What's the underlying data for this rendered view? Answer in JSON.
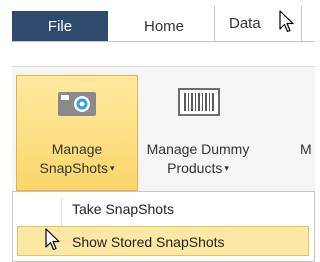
{
  "ribbon": {
    "tabs": [
      {
        "label": "File"
      },
      {
        "label": "Home"
      },
      {
        "label": "Data"
      }
    ],
    "groups": [
      {
        "label_line1": "Manage",
        "label_line2": "SnapShots",
        "icon": "camera-icon"
      },
      {
        "label_line1": "Manage Dummy",
        "label_line2": "Products",
        "icon": "barcode-icon"
      },
      {
        "label_line1": "M"
      }
    ],
    "dropdown_arrow": "▾"
  },
  "menu": {
    "items": [
      {
        "label": "Take SnapShots"
      },
      {
        "label": "Show Stored SnapShots"
      }
    ]
  },
  "colors": {
    "file_tab": "#2e4b6e",
    "highlight": "#fde7a5",
    "highlight_border": "#e9c25a"
  }
}
